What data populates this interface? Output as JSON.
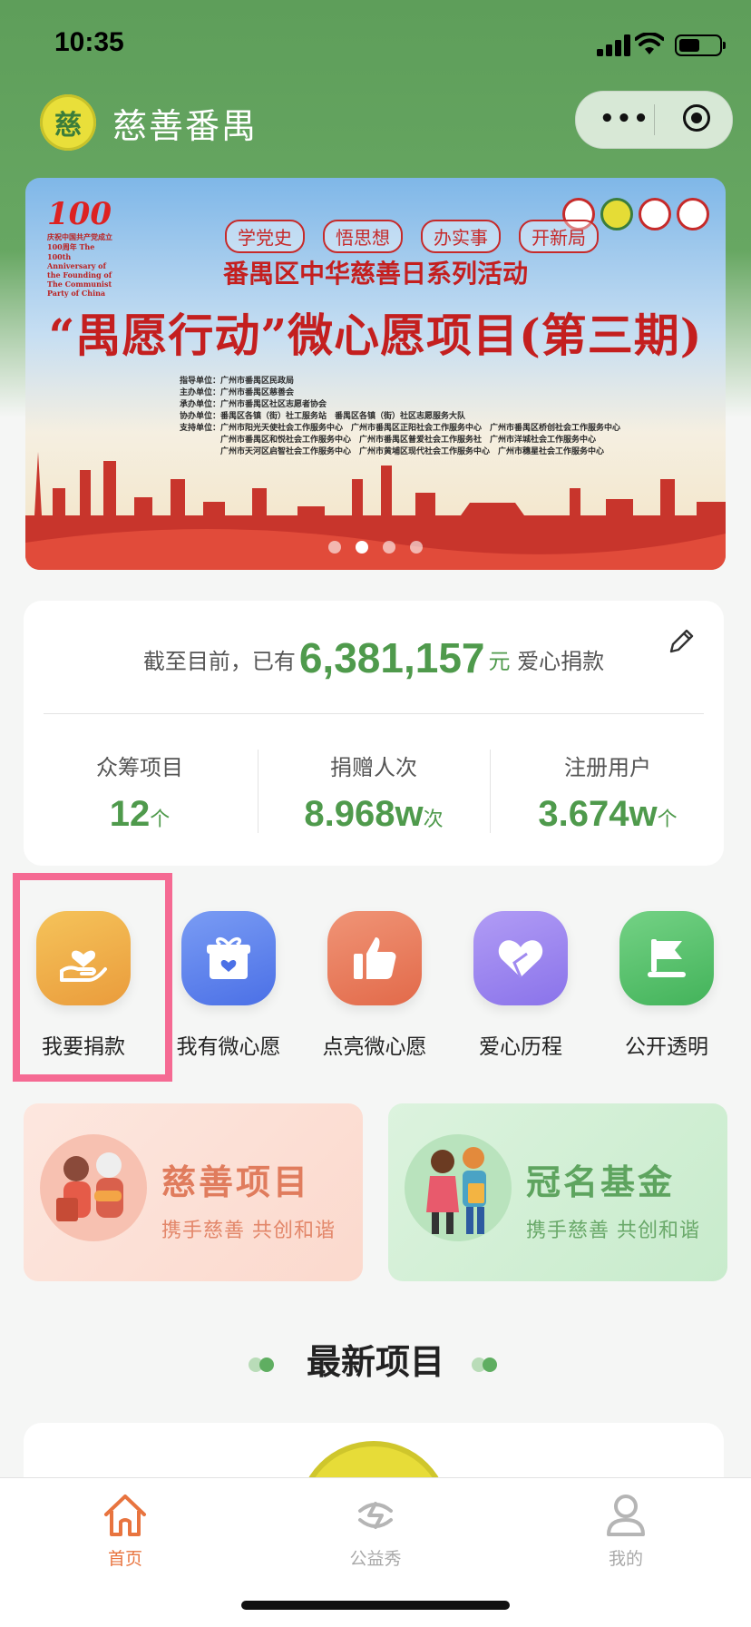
{
  "status_bar": {
    "time": "10:35"
  },
  "nav": {
    "logo_char": "慈",
    "title": "慈善番禺"
  },
  "banner": {
    "badge_number": "100",
    "badge_caption": "庆祝中国共产党成立100周年 The 100th Anniversary of the Founding of The Communist Party of China",
    "tags": [
      "学党史",
      "悟思想",
      "办实事",
      "开新局"
    ],
    "subtitle": "番禺区中华慈善日系列活动",
    "title": "“禺愿行动”微心愿项目(第三期)",
    "credits": [
      "指导单位：广州市番禺区民政局",
      "主办单位：广州市番禺区慈善会",
      "承办单位：广州市番禺区社区志愿者协会",
      "协办单位：番禺区各镇（街）社工服务站　番禺区各镇（街）社区志愿服务大队",
      "支持单位：广州市阳光天使社会工作服务中心　广州市番禺区正阳社会工作服务中心　广州市番禺区桥创社会工作服务中心",
      "　　　　　广州市番禺区和悦社会工作服务中心　广州市番禺区普爱社会工作服务社　广州市洋城社会工作服务中心",
      "　　　　　广州市天河区启智社会工作服务中心　广州市黄埔区现代社会工作服务中心　广州市穗星社会工作服务中心"
    ],
    "slide_count": 4,
    "active_slide": 1
  },
  "donations": {
    "prefix": "截至目前，已有",
    "amount": "6,381,157",
    "unit": "元",
    "suffix": "爱心捐款"
  },
  "stats": [
    {
      "label": "众筹项目",
      "value": "12",
      "unit": "个"
    },
    {
      "label": "捐赠人次",
      "value": "8.968w",
      "unit": "次"
    },
    {
      "label": "注册用户",
      "value": "3.674w",
      "unit": "个"
    }
  ],
  "quick_actions": [
    {
      "label": "我要捐款",
      "icon": "heart-hand-icon",
      "color": "#f0b24a"
    },
    {
      "label": "我有微心愿",
      "icon": "gift-icon",
      "color": "#5f84ee"
    },
    {
      "label": "点亮微心愿",
      "icon": "thumbs-up-icon",
      "color": "#ec7f5c"
    },
    {
      "label": "爱心历程",
      "icon": "heart-icon",
      "color": "#a08af0"
    },
    {
      "label": "公开透明",
      "icon": "flag-icon",
      "color": "#5cc36e"
    }
  ],
  "cards": [
    {
      "title": "慈善项目",
      "subtitle": "携手慈善 共创和谐"
    },
    {
      "title": "冠名基金",
      "subtitle": "携手慈善 共创和谐"
    }
  ],
  "section": {
    "title": "最新项目"
  },
  "tabbar": [
    {
      "label": "首页",
      "icon": "home-icon"
    },
    {
      "label": "公益秀",
      "icon": "charity-show-icon"
    },
    {
      "label": "我的",
      "icon": "profile-icon"
    }
  ]
}
